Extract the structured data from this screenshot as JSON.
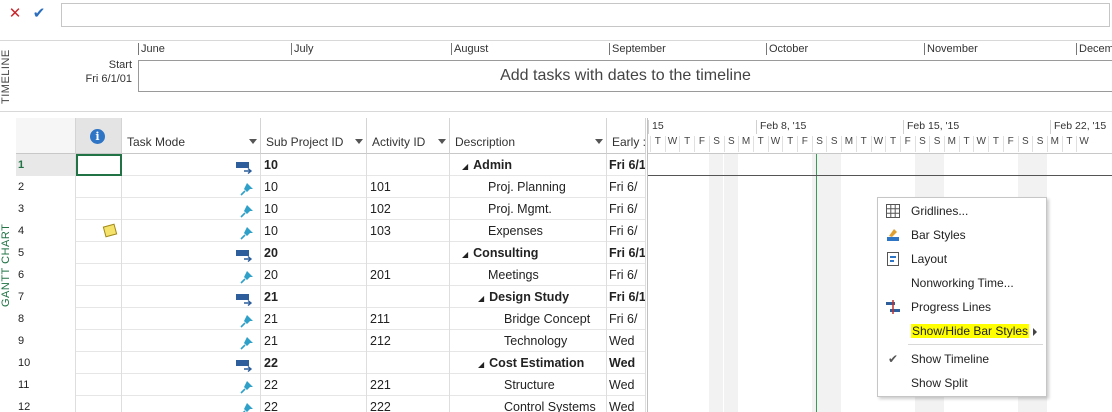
{
  "entry_bar": {
    "cancel": "✕",
    "confirm": "✔",
    "value": ""
  },
  "timeline": {
    "vertical_label": "TIMELINE",
    "start_label": "Start",
    "start_date": "Fri 6/1/01",
    "months": [
      "June",
      "July",
      "August",
      "September",
      "October",
      "November",
      "Decem"
    ],
    "placeholder": "Add tasks with dates to the timeline"
  },
  "gantt": {
    "vertical_label": "GANTT CHART",
    "columns": {
      "indicator": "i",
      "task_mode": "Task Mode",
      "sub_project": "Sub Project ID",
      "activity": "Activity ID",
      "description": "Description",
      "early_start": "Early :"
    },
    "rows": [
      {
        "num": "1",
        "mode": "auto",
        "sub": "10",
        "act": "",
        "desc": "Admin",
        "early": "Fri 6/1",
        "summary": true,
        "level": 0
      },
      {
        "num": "2",
        "mode": "manual",
        "sub": "10",
        "act": "101",
        "desc": "Proj. Planning",
        "early": "Fri 6/",
        "summary": false,
        "level": 1
      },
      {
        "num": "3",
        "mode": "manual",
        "sub": "10",
        "act": "102",
        "desc": "Proj. Mgmt.",
        "early": "Fri 6/",
        "summary": false,
        "level": 1
      },
      {
        "num": "4",
        "mode": "manual",
        "sub": "10",
        "act": "103",
        "desc": "Expenses",
        "early": "Fri 6/",
        "summary": false,
        "level": 1,
        "note": true
      },
      {
        "num": "5",
        "mode": "auto",
        "sub": "20",
        "act": "",
        "desc": "Consulting",
        "early": "Fri 6/1",
        "summary": true,
        "level": 0
      },
      {
        "num": "6",
        "mode": "manual",
        "sub": "20",
        "act": "201",
        "desc": "Meetings",
        "early": "Fri 6/",
        "summary": false,
        "level": 1
      },
      {
        "num": "7",
        "mode": "auto",
        "sub": "21",
        "act": "",
        "desc": "Design Study",
        "early": "Fri 6/1",
        "summary": true,
        "level": 1
      },
      {
        "num": "8",
        "mode": "manual",
        "sub": "21",
        "act": "211",
        "desc": "Bridge Concept",
        "early": "Fri 6/",
        "summary": false,
        "level": 2
      },
      {
        "num": "9",
        "mode": "manual",
        "sub": "21",
        "act": "212",
        "desc": "Technology",
        "early": "Wed",
        "summary": false,
        "level": 2
      },
      {
        "num": "10",
        "mode": "auto",
        "sub": "22",
        "act": "",
        "desc": "Cost Estimation",
        "early": "Wed",
        "summary": true,
        "level": 1
      },
      {
        "num": "11",
        "mode": "manual",
        "sub": "22",
        "act": "221",
        "desc": "Structure",
        "early": "Wed",
        "summary": false,
        "level": 2
      },
      {
        "num": "12",
        "mode": "manual",
        "sub": "22",
        "act": "222",
        "desc": "Control Systems",
        "early": "Wed",
        "summary": false,
        "level": 2
      }
    ]
  },
  "chart": {
    "weeks": [
      "15",
      "Feb 8, '15",
      "Feb 15, '15",
      "Feb 22, '15"
    ],
    "days": [
      "T",
      "W",
      "T",
      "F",
      "S",
      "S",
      "M",
      "T",
      "W",
      "T",
      "F",
      "S",
      "S",
      "M",
      "T",
      "W",
      "T",
      "F",
      "S",
      "S",
      "M",
      "T",
      "W",
      "T",
      "F",
      "S",
      "S",
      "M",
      "T",
      "W"
    ]
  },
  "menu": {
    "items": [
      {
        "label": "Gridlines...",
        "icon": "gridlines-icon"
      },
      {
        "label": "Bar Styles",
        "icon": "bar-styles-icon"
      },
      {
        "label": "Layout",
        "icon": "layout-icon"
      },
      {
        "label": "Nonworking Time...",
        "icon": ""
      },
      {
        "label": "Progress Lines",
        "icon": "progress-lines-icon"
      },
      {
        "label": "Show/Hide Bar Styles",
        "icon": "",
        "submenu": true,
        "highlight": true
      },
      {
        "label": "Show Timeline",
        "icon": "check-icon"
      },
      {
        "label": "Show Split",
        "icon": ""
      }
    ],
    "highlight_color": "#ffff00"
  }
}
